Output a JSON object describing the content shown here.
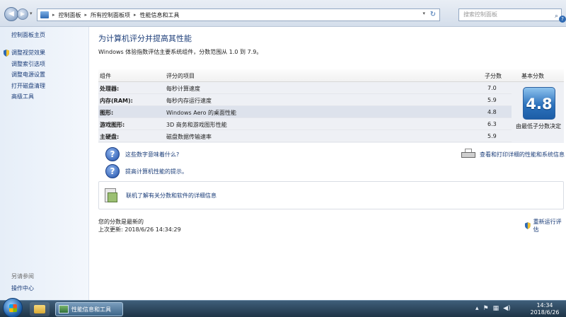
{
  "address": {
    "crumbs": [
      "控制面板",
      "所有控制面板项",
      "性能信息和工具"
    ],
    "search_placeholder": "搜索控制面板"
  },
  "sidebar": {
    "home": "控制面板主页",
    "items": [
      {
        "label": "调整视觉效果",
        "shield": true
      },
      {
        "label": "调整索引选项",
        "shield": false
      },
      {
        "label": "调整电源设置",
        "shield": false
      },
      {
        "label": "打开磁盘清理",
        "shield": false
      },
      {
        "label": "高级工具",
        "shield": false
      }
    ],
    "see_also": "另请参阅",
    "action_center": "操作中心"
  },
  "main": {
    "title": "为计算机评分并提高其性能",
    "subtitle": "Windows 体验指数评估主要系统组件，分数范围从 1.0 到 7.9。",
    "table": {
      "headers": {
        "component": "组件",
        "rated": "评分的项目",
        "subscore": "子分数",
        "basescore": "基本分数"
      },
      "rows": [
        {
          "component": "处理器:",
          "item": "每秒计算速度",
          "score": "7.0"
        },
        {
          "component": "内存(RAM):",
          "item": "每秒内存运行速度",
          "score": "5.9"
        },
        {
          "component": "图形:",
          "item": "Windows Aero 的桌面性能",
          "score": "4.8"
        },
        {
          "component": "游戏图形:",
          "item": "3D 商务和游戏图形性能",
          "score": "6.3"
        },
        {
          "component": "主硬盘:",
          "item": "磁盘数据传输速率",
          "score": "5.9"
        }
      ],
      "base_score": "4.8",
      "base_caption": "由最低子分数决定"
    },
    "help_links": [
      "这些数字意味着什么?",
      "提高计算机性能的提示。"
    ],
    "print_link": "查看和打印详细的性能和系统信息",
    "online_link": "联机了解有关分数和软件的详细信息",
    "status_current": "您的分数是最新的",
    "last_update": "上次更新: 2018/6/26 14:34:29",
    "rerun": "重新运行评估"
  },
  "taskbar": {
    "task_label": "性能信息和工具",
    "time": "14:34",
    "date": "2018/6/26"
  }
}
